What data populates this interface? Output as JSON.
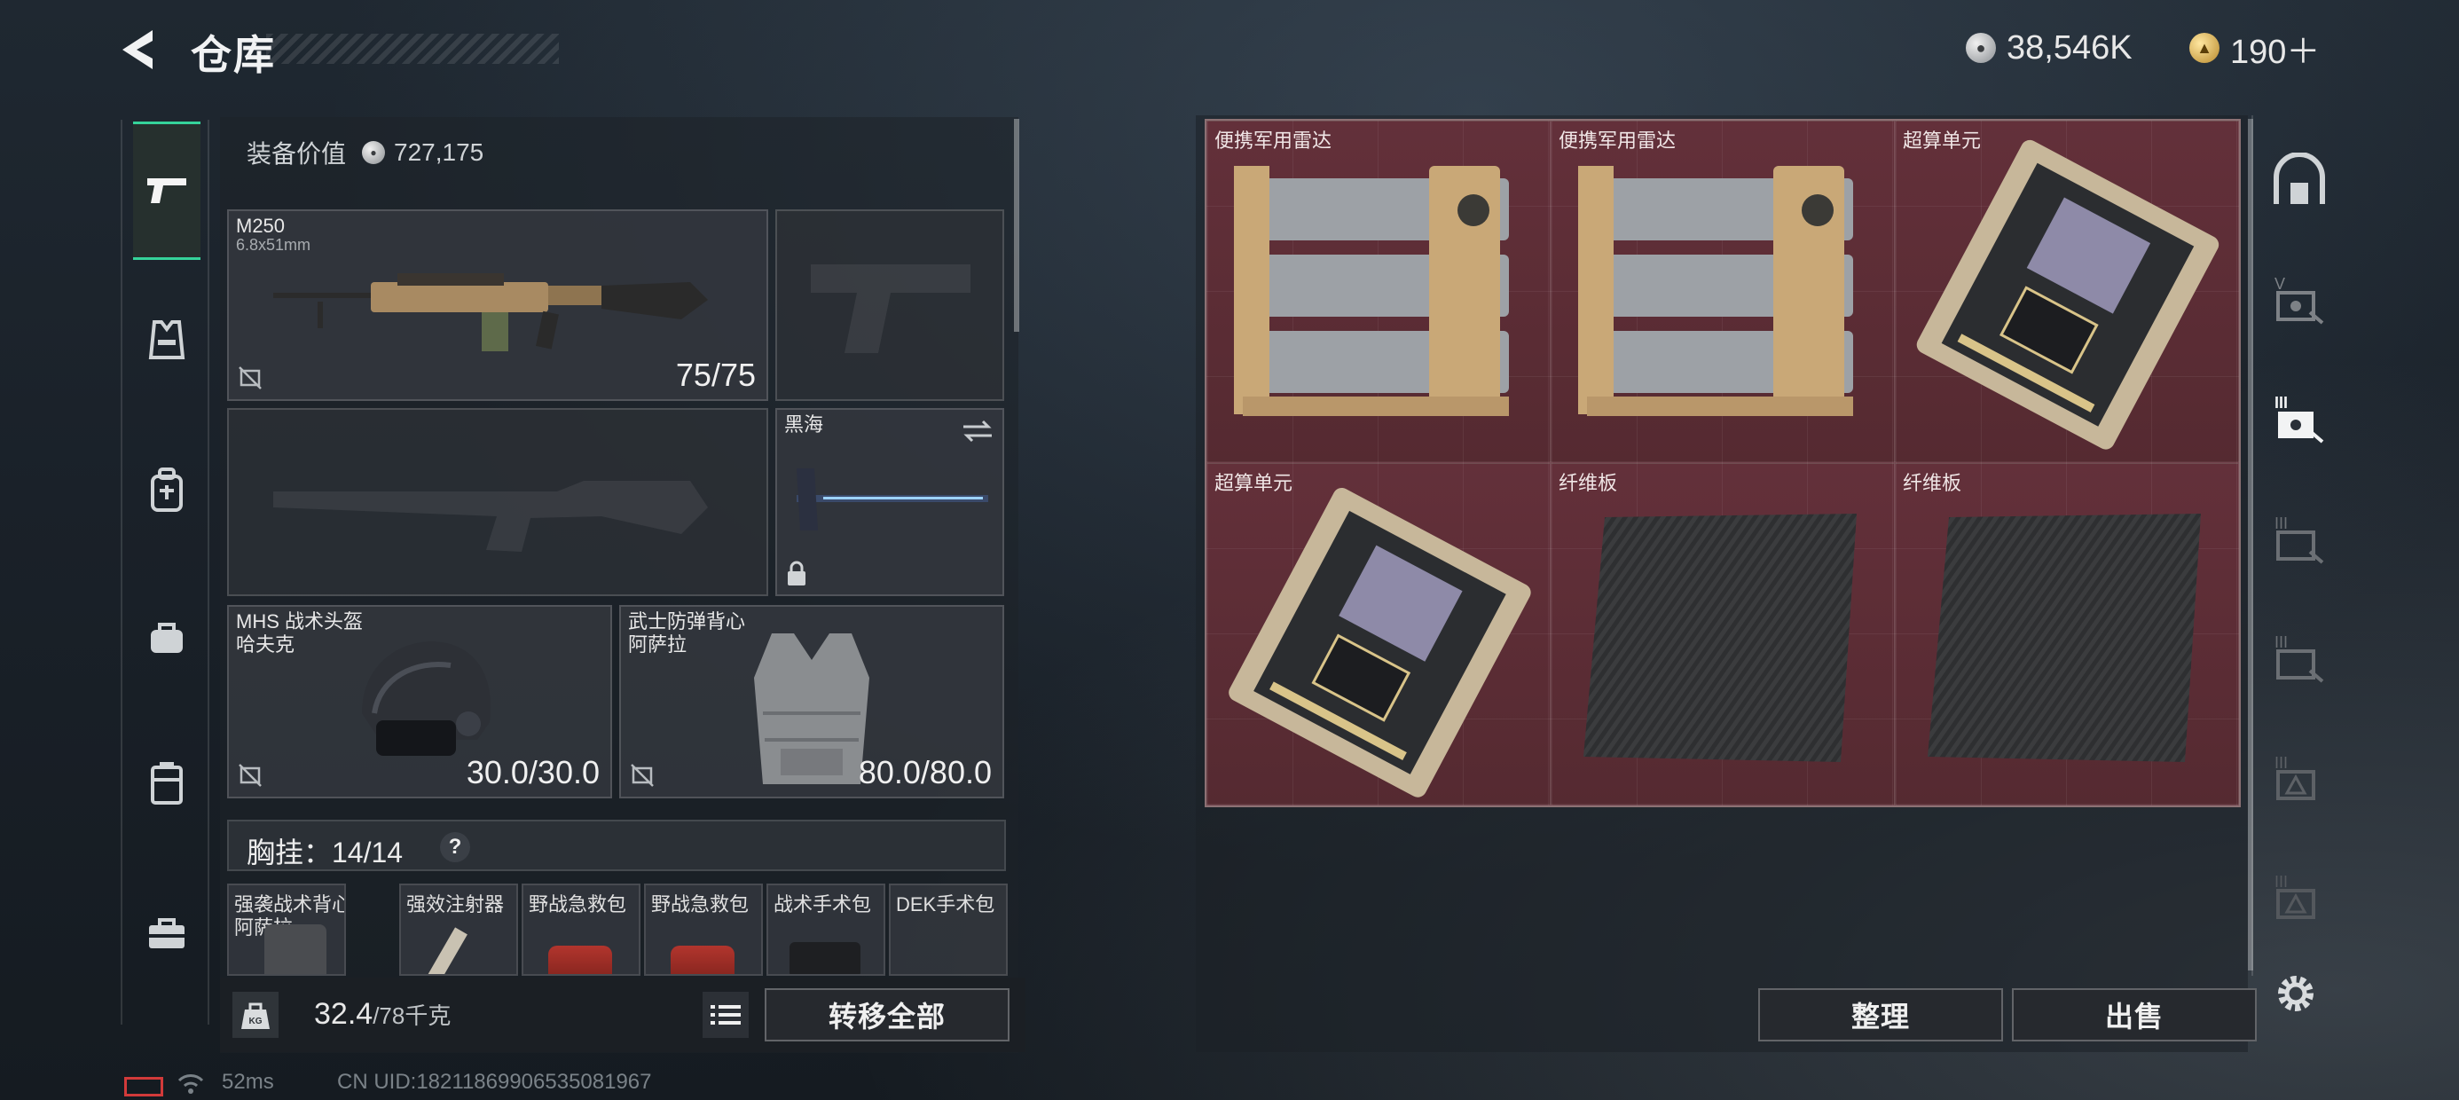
{
  "header": {
    "title": "仓库"
  },
  "currencies": {
    "silver": "38,546K",
    "gold": "190＋"
  },
  "equipment_value": {
    "label": "装备价值",
    "value": "727,175"
  },
  "left_tabs": [
    "firearms",
    "armor",
    "backpack",
    "bag",
    "locker",
    "toolbox"
  ],
  "loadout": {
    "primary": {
      "name": "M250",
      "caliber": "6.8x51mm",
      "ammo": "75/75"
    },
    "melee": {
      "name": "黑海"
    },
    "helmet": {
      "name": "MHS 战术头盔",
      "maker": "哈夫克",
      "durability": "30.0/30.0"
    },
    "vest": {
      "name": "武士防弹背心",
      "maker": "阿萨拉",
      "durability": "80.0/80.0"
    },
    "chest_rig": {
      "label": "胸挂：14/14",
      "help": "?"
    },
    "chest_items": [
      {
        "line1": "强袭战术背心",
        "line2": "阿萨拉"
      },
      {
        "line1": "强效注射器"
      },
      {
        "line1": "野战急救包"
      },
      {
        "line1": "野战急救包"
      },
      {
        "line1": "战术手术包"
      },
      {
        "line1": "DEK手术包"
      }
    ],
    "weight": {
      "current": "32.4",
      "max": "/78千克",
      "icon": "KG"
    },
    "transfer_all": "转移全部"
  },
  "container": {
    "items": [
      {
        "name": "便携军用雷达",
        "kind": "radar"
      },
      {
        "name": "便携军用雷达",
        "kind": "radar"
      },
      {
        "name": "超算单元",
        "kind": "chip"
      },
      {
        "name": "超算单元",
        "kind": "chip"
      },
      {
        "name": "纤维板",
        "kind": "panel"
      },
      {
        "name": "纤维板",
        "kind": "panel"
      }
    ],
    "sort_button": "整理",
    "sell_button": "出售"
  },
  "status": {
    "ping": "52ms",
    "uid": "CN UID:18211869906535081967"
  },
  "colors": {
    "accent": "#35d39a",
    "container_bg": "#5b2b30"
  }
}
